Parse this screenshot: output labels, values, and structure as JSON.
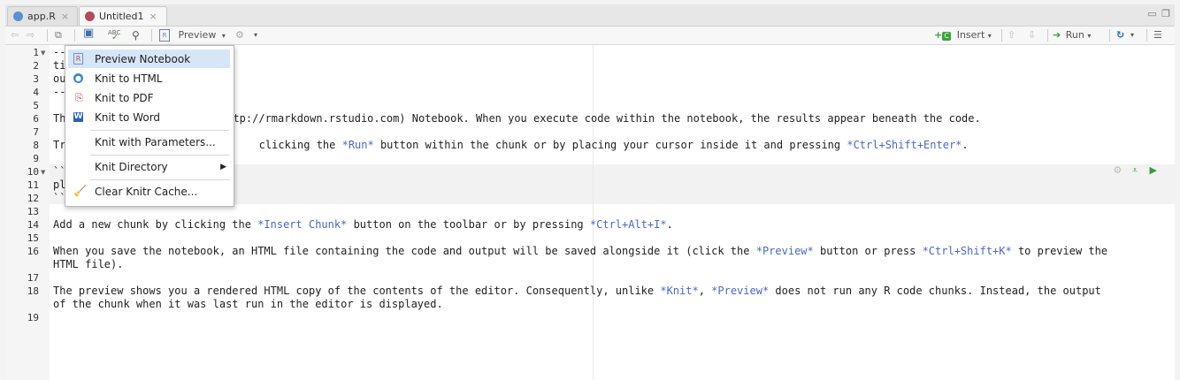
{
  "tabs": [
    {
      "label": "app.R",
      "close": "×"
    },
    {
      "label": "Untitled1",
      "close": "×"
    }
  ],
  "toolbar": {
    "preview_label": "Preview",
    "insert_label": "Insert",
    "run_label": "Run",
    "spell_abc": "ABC"
  },
  "line_numbers": [
    "1",
    "2",
    "3",
    "4",
    "5",
    "6",
    "7",
    "8",
    "9",
    "10",
    "11",
    "12",
    "13",
    "14",
    "15",
    "16",
    "17",
    "18",
    "19"
  ],
  "code_lines": {
    "l1": "--",
    "l2": "ti",
    "l3": "ou",
    "l4": "--",
    "l6_pre": "Th",
    "l6_post": "tp://rmarkdown.rstudio.com) Notebook. When you execute code within the notebook, the results appear beneath the code.",
    "l8_pre": "Tr",
    "l8_a": " clicking the ",
    "l8_run": "*Run*",
    "l8_b": " button within the chunk or by placing your cursor inside it and pressing ",
    "l8_key": "*Ctrl+Shift+Enter*",
    "l8_c": ".",
    "l10": "``",
    "l11": "pl",
    "l12": "``",
    "l14_a": "Add a new chunk by clicking the ",
    "l14_em": "*Insert Chunk*",
    "l14_b": " button on the toolbar or by pressing ",
    "l14_key": "*Ctrl+Alt+I*",
    "l14_c": ".",
    "l16_a": "When you save the notebook, an HTML file containing the code and output will be saved alongside it (click the ",
    "l16_em": "*Preview*",
    "l16_b": " button or press ",
    "l16_key": "*Ctrl+Shift+K*",
    "l16_c": " to preview the",
    "l16_2": "HTML file).",
    "l18_a": "The preview shows you a rendered HTML copy of the contents of the editor. Consequently, unlike ",
    "l18_knit": "*Knit*",
    "l18_b": ", ",
    "l18_prev": "*Preview*",
    "l18_c": " does not run any R code chunks. Instead, the output",
    "l18_2": "of the chunk when it was last run in the editor is displayed."
  },
  "menu": {
    "items": [
      {
        "label": "Preview Notebook",
        "icon": "notebook-icon"
      },
      {
        "label": "Knit to HTML",
        "icon": "globe-icon"
      },
      {
        "label": "Knit to PDF",
        "icon": "pdf-icon"
      },
      {
        "label": "Knit to Word",
        "icon": "word-icon"
      },
      {
        "label": "Knit with Parameters..."
      },
      {
        "label": "Knit Directory",
        "submenu": "▶"
      },
      {
        "label": "Clear Knitr Cache...",
        "icon": "broom-icon"
      }
    ]
  },
  "colors": {
    "menu_highlight": "#d6e6f7",
    "emphasis_text": "#4b69c6",
    "run_green": "#3a9a3a",
    "insert_green": "#3aa33a"
  }
}
